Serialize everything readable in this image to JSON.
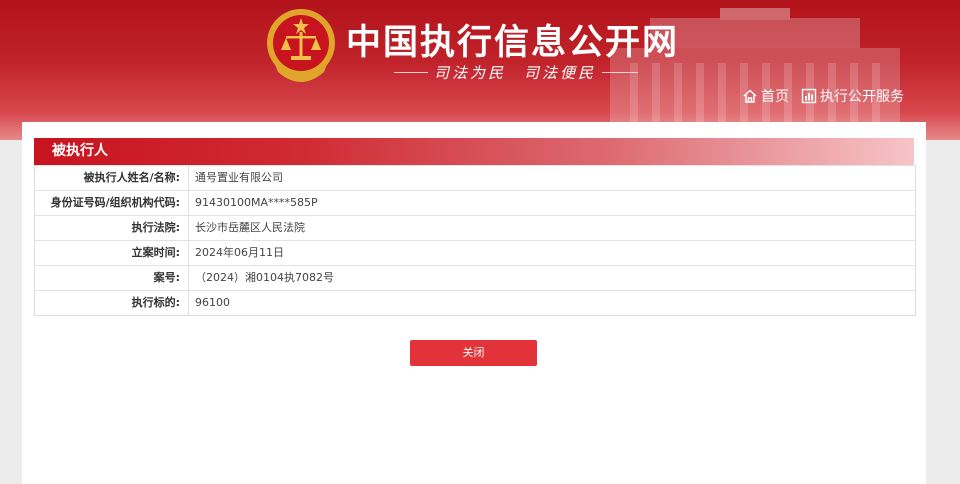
{
  "header": {
    "site_title": "中国执行信息公开网",
    "slogan": "司法为民　司法便民",
    "nav": [
      {
        "label": "首页",
        "icon": "home-icon"
      },
      {
        "label": "执行公开服务",
        "icon": "chart-icon"
      }
    ]
  },
  "section": {
    "title": "被执行人",
    "rows": [
      {
        "label": "被执行人姓名/名称:",
        "value": "通号置业有限公司"
      },
      {
        "label": "身份证号码/组织机构代码:",
        "value": "91430100MA****585P"
      },
      {
        "label": "执行法院:",
        "value": "长沙市岳麓区人民法院"
      },
      {
        "label": "立案时间:",
        "value": "2024年06月11日"
      },
      {
        "label": "案号:",
        "value": "（2024）湘0104执7082号"
      },
      {
        "label": "执行标的:",
        "value": "96100"
      }
    ]
  },
  "actions": {
    "close_label": "关闭"
  },
  "colors": {
    "header_red": "#c1232b",
    "button_red": "#e2323a",
    "emblem_gold": "#e0a52a"
  }
}
